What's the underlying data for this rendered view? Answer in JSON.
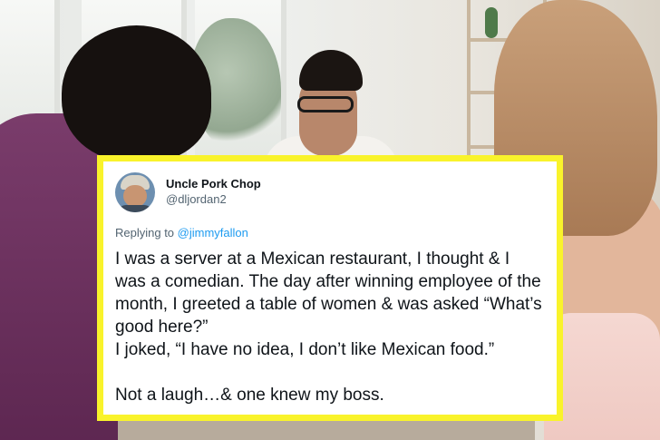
{
  "tweet": {
    "display_name": "Uncle Pork Chop",
    "handle": "@dljordan2",
    "reply_prefix": "Replying to ",
    "reply_to": "@jimmyfallon",
    "text": "I was a server at a Mexican restaurant, I thought & I was a comedian. The day after winning employee of the month, I greeted a table of women & was asked “What’s good here?”\nI joked, “I have no idea, I don’t like Mexican food.”\n\nNot a laugh…& one knew my boss."
  },
  "colors": {
    "frame": "#f9f32b",
    "mention": "#1d9bf0",
    "secondary_text": "#536471",
    "primary_text": "#0f1419"
  },
  "icons": {
    "avatar": "profile-photo"
  }
}
